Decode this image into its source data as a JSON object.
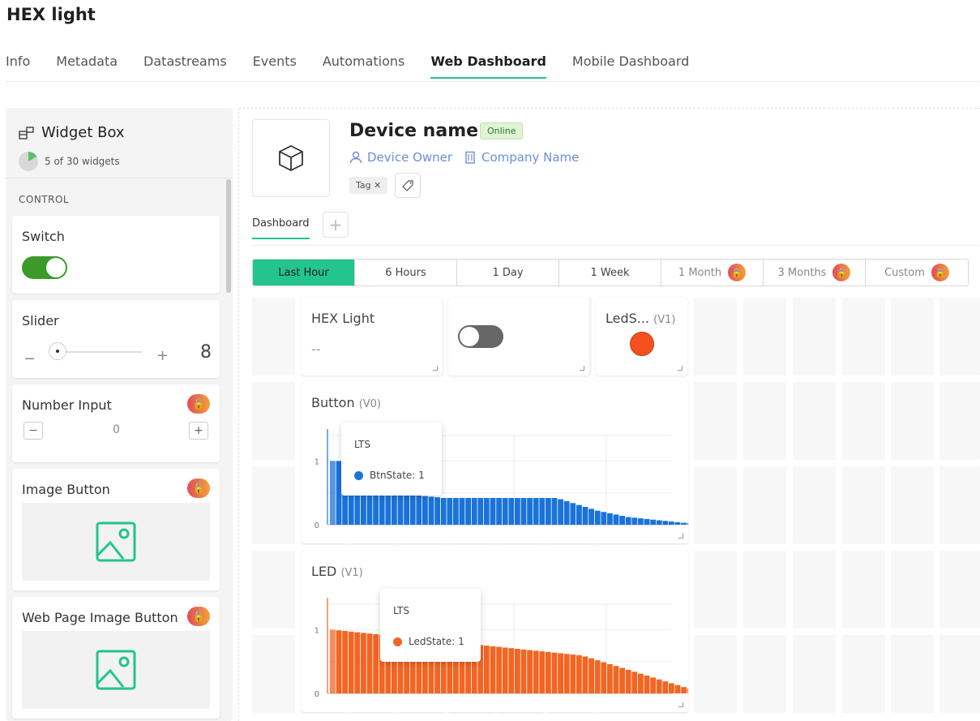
{
  "app": {
    "title": "HEX light"
  },
  "tabs": [
    {
      "label": "Info",
      "active": false
    },
    {
      "label": "Metadata",
      "active": false
    },
    {
      "label": "Datastreams",
      "active": false
    },
    {
      "label": "Events",
      "active": false
    },
    {
      "label": "Automations",
      "active": false
    },
    {
      "label": "Web Dashboard",
      "active": true
    },
    {
      "label": "Mobile Dashboard",
      "active": false
    }
  ],
  "widget_box": {
    "title": "Widget Box",
    "count_text": "5 of 30 widgets",
    "section": "CONTROL",
    "items": [
      {
        "label": "Switch"
      },
      {
        "label": "Slider",
        "value": "8"
      },
      {
        "label": "Number Input",
        "value": "0",
        "locked": true
      },
      {
        "label": "Image Button",
        "locked": true
      },
      {
        "label": "Web Page Image Button",
        "locked": true
      }
    ]
  },
  "device": {
    "name": "Device name",
    "status": "Online",
    "owner": "Device Owner",
    "company": "Company Name",
    "tag": "Tag"
  },
  "dashboard": {
    "tab": "Dashboard",
    "time_ranges": [
      {
        "label": "Last Hour",
        "active": true,
        "locked": false
      },
      {
        "label": "6 Hours",
        "active": false,
        "locked": false
      },
      {
        "label": "1 Day",
        "active": false,
        "locked": false
      },
      {
        "label": "1 Week",
        "active": false,
        "locked": false
      },
      {
        "label": "1 Month",
        "active": false,
        "locked": true
      },
      {
        "label": "3 Months",
        "active": false,
        "locked": true
      },
      {
        "label": "Custom",
        "active": false,
        "locked": true
      }
    ],
    "tiles": {
      "hex_light": {
        "title": "HEX Light",
        "value": "--"
      },
      "leds": {
        "title": "LedS...",
        "pin": "(V1)",
        "color": "#f26522"
      }
    },
    "colors": {
      "accent": "#23c48e",
      "blue": "#1a73d9",
      "orange": "#f26522"
    }
  },
  "chart_data": [
    {
      "type": "bar",
      "title": "Button",
      "pin": "(V0)",
      "yticks": [
        "0",
        "1"
      ],
      "ylim": [
        0,
        1.4
      ],
      "series": [
        {
          "name": "BtnState",
          "color": "#1a73d9",
          "values": [
            1,
            1,
            0.95,
            0.9,
            0.85,
            0.8,
            0.75,
            0.7,
            0.65,
            0.6,
            0.56,
            0.53,
            0.5,
            0.48,
            0.46,
            0.45,
            0.44,
            0.43,
            0.42,
            0.42,
            0.42,
            0.42,
            0.42,
            0.42,
            0.42,
            0.42,
            0.42,
            0.42,
            0.42,
            0.42,
            0.42,
            0.42,
            0.42,
            0.42,
            0.42,
            0.42,
            0.42,
            0.4,
            0.37,
            0.34,
            0.31,
            0.28,
            0.25,
            0.22,
            0.2,
            0.18,
            0.16,
            0.14,
            0.12,
            0.11,
            0.1,
            0.09,
            0.08,
            0.07,
            0.06,
            0.05,
            0.04,
            0.03,
            0.025,
            0.02,
            0.015,
            0.01,
            0.008,
            0.005,
            0.003
          ]
        }
      ],
      "tooltip": {
        "title": "LTS",
        "label": "BtnState: 1"
      }
    },
    {
      "type": "bar",
      "title": "LED",
      "pin": "(V1)",
      "yticks": [
        "0",
        "1"
      ],
      "ylim": [
        0,
        1.4
      ],
      "series": [
        {
          "name": "LedState",
          "color": "#f26522",
          "values": [
            1,
            0.99,
            0.98,
            0.97,
            0.96,
            0.95,
            0.94,
            0.93,
            0.92,
            0.91,
            0.9,
            0.89,
            0.88,
            0.87,
            0.86,
            0.85,
            0.84,
            0.83,
            0.82,
            0.81,
            0.8,
            0.79,
            0.78,
            0.77,
            0.76,
            0.75,
            0.74,
            0.73,
            0.72,
            0.71,
            0.7,
            0.69,
            0.68,
            0.67,
            0.66,
            0.65,
            0.64,
            0.63,
            0.62,
            0.61,
            0.6,
            0.58,
            0.55,
            0.52,
            0.49,
            0.46,
            0.43,
            0.4,
            0.37,
            0.34,
            0.31,
            0.28,
            0.25,
            0.22,
            0.19,
            0.16,
            0.13,
            0.1,
            0.08,
            0.06,
            0.04,
            0.02
          ]
        }
      ],
      "tooltip": {
        "title": "LTS",
        "label": "LedState: 1"
      }
    }
  ]
}
